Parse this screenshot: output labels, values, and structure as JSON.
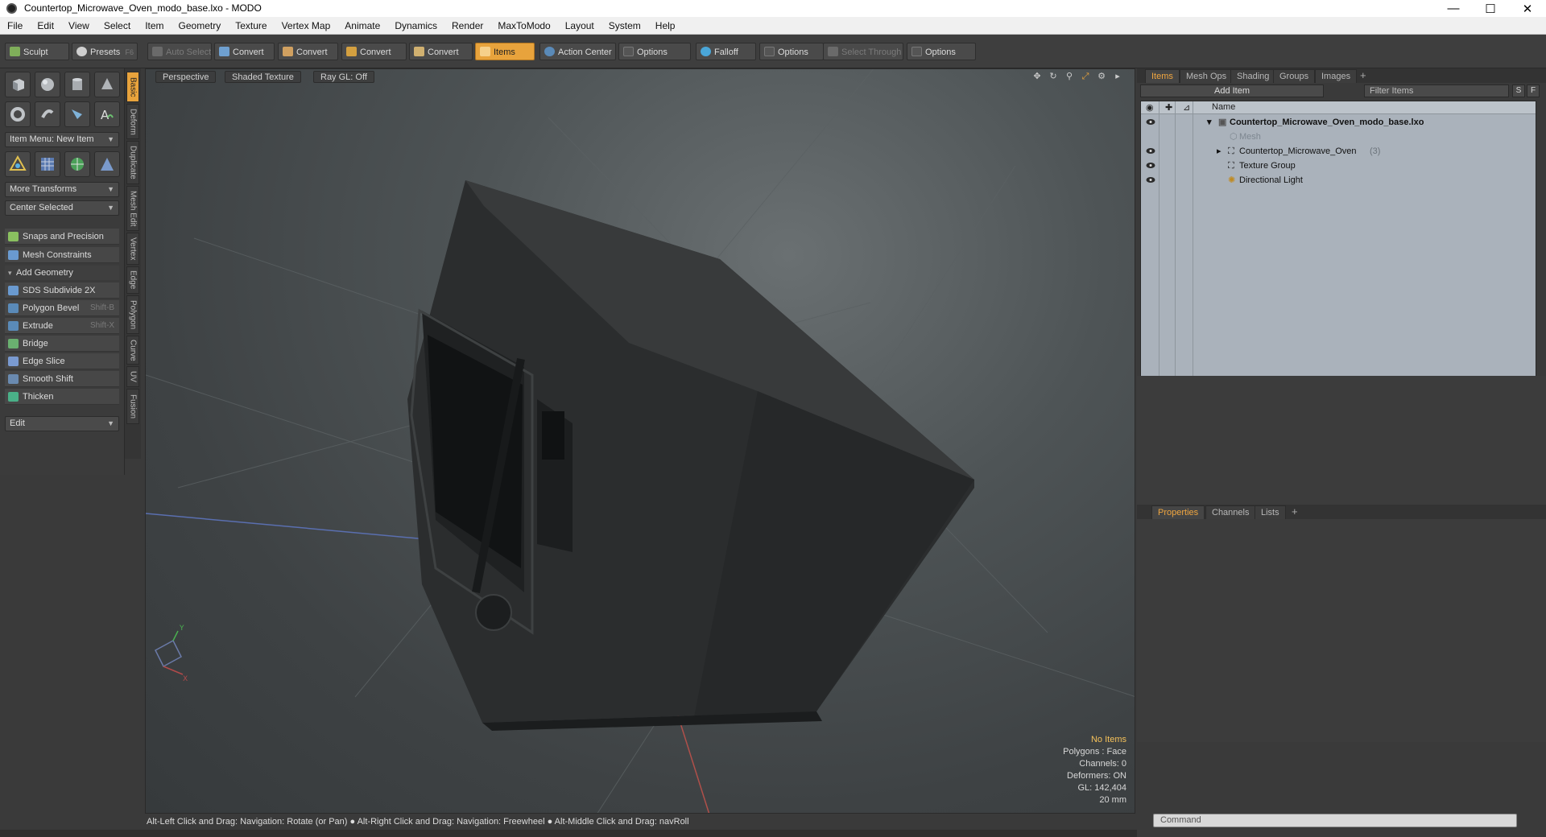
{
  "window": {
    "title": "Countertop_Microwave_Oven_modo_base.lxo - MODO",
    "controls": [
      "—",
      "☐",
      "✕"
    ]
  },
  "menu": [
    "File",
    "Edit",
    "View",
    "Select",
    "Item",
    "Geometry",
    "Texture",
    "Vertex Map",
    "Animate",
    "Dynamics",
    "Render",
    "MaxToModo",
    "Layout",
    "System",
    "Help"
  ],
  "toolbar": {
    "sculpt": "Sculpt",
    "presets": "Presets",
    "presets_key": "F6",
    "auto_select": "Auto Select",
    "convert1": "Convert",
    "convert2": "Convert",
    "convert3": "Convert",
    "convert4": "Convert",
    "items": "Items",
    "action_center": "Action Center",
    "options1": "Options",
    "falloff": "Falloff",
    "options2": "Options",
    "select_through": "Select Through",
    "options3": "Options"
  },
  "left": {
    "item_menu": "Item Menu: New Item",
    "more_transforms": "More Transforms",
    "center_selected": "Center Selected",
    "snaps": "Snaps and Precision",
    "mesh_constraints": "Mesh Constraints",
    "add_geometry": "Add Geometry",
    "tools": [
      {
        "label": "SDS Subdivide 2X",
        "key": ""
      },
      {
        "label": "Polygon Bevel",
        "key": "Shift-B"
      },
      {
        "label": "Extrude",
        "key": "Shift-X"
      },
      {
        "label": "Bridge",
        "key": ""
      },
      {
        "label": "Edge Slice",
        "key": ""
      },
      {
        "label": "Smooth Shift",
        "key": ""
      },
      {
        "label": "Thicken",
        "key": ""
      }
    ],
    "edit": "Edit",
    "vtabs": [
      "Basic",
      "Deform",
      "Duplicate",
      "Mesh Edit",
      "Vertex",
      "Edge",
      "Polygon",
      "Curve",
      "UV",
      "Fusion"
    ]
  },
  "viewport": {
    "perspective": "Perspective",
    "shading": "Shaded Texture",
    "raygl": "Ray GL: Off",
    "stats": {
      "selection": "No Items",
      "polygons": "Polygons : Face",
      "channels": "Channels: 0",
      "deformers": "Deformers: ON",
      "gl": "GL: 142,404",
      "scale": "20 mm"
    }
  },
  "status": "Alt-Left Click and Drag: Navigation: Rotate (or Pan) ● Alt-Right Click and Drag: Navigation: Freewheel ● Alt-Middle Click and Drag: navRoll",
  "items_panel": {
    "tabs": [
      "Items",
      "Mesh Ops",
      "Shading",
      "Groups",
      "Images"
    ],
    "add_item": "Add Item",
    "filter": "Filter Items",
    "s_btn": "S",
    "f_btn": "F",
    "name_header": "Name",
    "tree": [
      {
        "label": "Countertop_Microwave_Oven_modo_base.lxo",
        "suffix": ""
      },
      {
        "label": "Mesh",
        "suffix": ""
      },
      {
        "label": "Countertop_Microwave_Oven",
        "suffix": "(3)"
      },
      {
        "label": "Texture Group",
        "suffix": ""
      },
      {
        "label": "Directional Light",
        "suffix": ""
      }
    ]
  },
  "props_panel": {
    "tabs": [
      "Properties",
      "Channels",
      "Lists"
    ]
  },
  "command": {
    "placeholder": "Command"
  }
}
